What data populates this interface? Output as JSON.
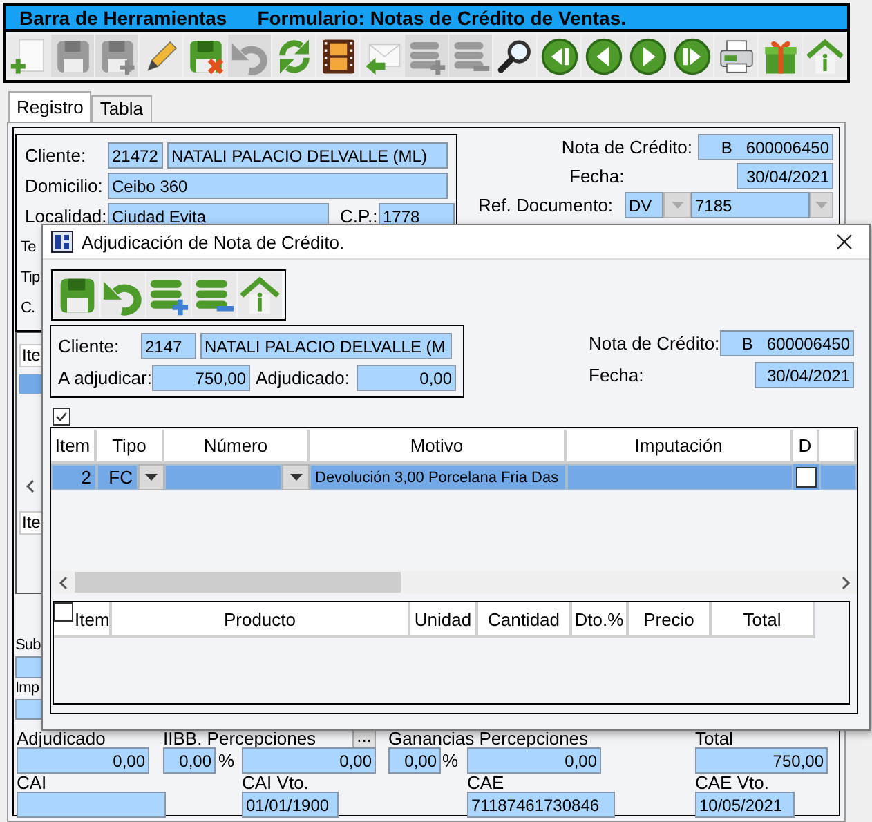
{
  "toolbar": {
    "title": "Barra de Herramientas",
    "form_title": "Formulario: Notas de Crédito de Ventas.",
    "buttons": [
      {
        "kind": "new",
        "disabled": false
      },
      {
        "kind": "save",
        "disabled": true
      },
      {
        "kind": "save-as",
        "disabled": true
      },
      {
        "kind": "edit",
        "disabled": false
      },
      {
        "kind": "cancel",
        "disabled": false
      },
      {
        "kind": "undo",
        "disabled": true
      },
      {
        "kind": "refresh",
        "disabled": false
      },
      {
        "kind": "film",
        "disabled": false
      },
      {
        "kind": "reply",
        "disabled": false
      },
      {
        "kind": "add-rows",
        "disabled": true
      },
      {
        "kind": "remove-rows",
        "disabled": true
      },
      {
        "kind": "search",
        "disabled": false
      },
      {
        "kind": "first",
        "disabled": false
      },
      {
        "kind": "previous",
        "disabled": false
      },
      {
        "kind": "next",
        "disabled": false
      },
      {
        "kind": "last",
        "disabled": false
      },
      {
        "kind": "print",
        "disabled": false
      },
      {
        "kind": "gift",
        "disabled": false
      },
      {
        "kind": "home",
        "disabled": false
      }
    ]
  },
  "tabs": [
    {
      "label": "Registro",
      "selected": true
    },
    {
      "label": "Tabla",
      "selected": false
    }
  ],
  "form": {
    "cliente": {
      "label": "Cliente:",
      "code": "21472",
      "name": "NATALI PALACIO DELVALLE (ML)"
    },
    "domicilio": {
      "label": "Domicilio:",
      "value": "Ceibo 360"
    },
    "localidad": {
      "label": "Localidad:",
      "value": "Ciudad Evita",
      "cp_label": "C.P.:",
      "cp": "1778"
    },
    "covered_labels": [
      "Te",
      "Tip",
      "C."
    ],
    "nota_credito": {
      "label": "Nota de Crédito:",
      "letter": "B",
      "number": "600006450"
    },
    "fecha": {
      "label": "Fecha:",
      "value": "30/04/2021"
    },
    "ref_documento": {
      "label": "Ref. Documento:",
      "type": "DV",
      "number": "7185"
    },
    "grid_fragment": {
      "header": "Ite",
      "detail_header": "Ite"
    },
    "subtotal_label": "Sub",
    "impuesto_label": "Imp",
    "totals": {
      "adjudicado": {
        "label": "Adjudicado",
        "value": "0,00"
      },
      "iibb": {
        "label": "IIBB. Percepciones",
        "button": "...",
        "percent": "0,00",
        "percent_sign": "%",
        "amount": "0,00"
      },
      "ganancias": {
        "label": "Ganancias Percepciones",
        "percent": "0,00",
        "percent_sign": "%",
        "amount": "0,00"
      },
      "total": {
        "label": "Total",
        "value": "750,00"
      },
      "cai": {
        "label": "CAI"
      },
      "cai_vto": {
        "label": "CAI Vto.",
        "value": "01/01/1900"
      },
      "cae": {
        "label": "CAE",
        "value": "71187461730846"
      },
      "cae_vto": {
        "label": "CAE Vto.",
        "value": "10/05/2021"
      }
    }
  },
  "dialog": {
    "title": "Adjudicación de Nota de Crédito.",
    "toolbar": [
      {
        "kind": "save"
      },
      {
        "kind": "undo"
      },
      {
        "kind": "add-rows"
      },
      {
        "kind": "remove-rows"
      },
      {
        "kind": "home"
      }
    ],
    "cliente": {
      "label": "Cliente:",
      "code": "2147",
      "name": "NATALI PALACIO DELVALLE (M"
    },
    "a_adjudicar": {
      "label": "A adjudicar:",
      "value": "750,00"
    },
    "adjudicado": {
      "label": "Adjudicado:",
      "value": "0,00"
    },
    "nota_credito": {
      "label": "Nota de Crédito:",
      "letter": "B",
      "number": "600006450"
    },
    "fecha": {
      "label": "Fecha:",
      "value": "30/04/2021"
    },
    "show_all_checked": true,
    "grid": {
      "columns": [
        "Item",
        "Tipo",
        "Número",
        "Motivo",
        "Imputación",
        "D"
      ],
      "rows": [
        {
          "item": "2",
          "tipo": "FC",
          "motivo": "Devolución 3,00 Porcelana Fria Das",
          "d_checked": false,
          "selected": true
        }
      ]
    },
    "detail": {
      "select_checked": false,
      "columns": [
        "Item",
        "Producto",
        "Unidad",
        "Cantidad",
        "Dto.%",
        "Precio",
        "Total"
      ]
    }
  }
}
